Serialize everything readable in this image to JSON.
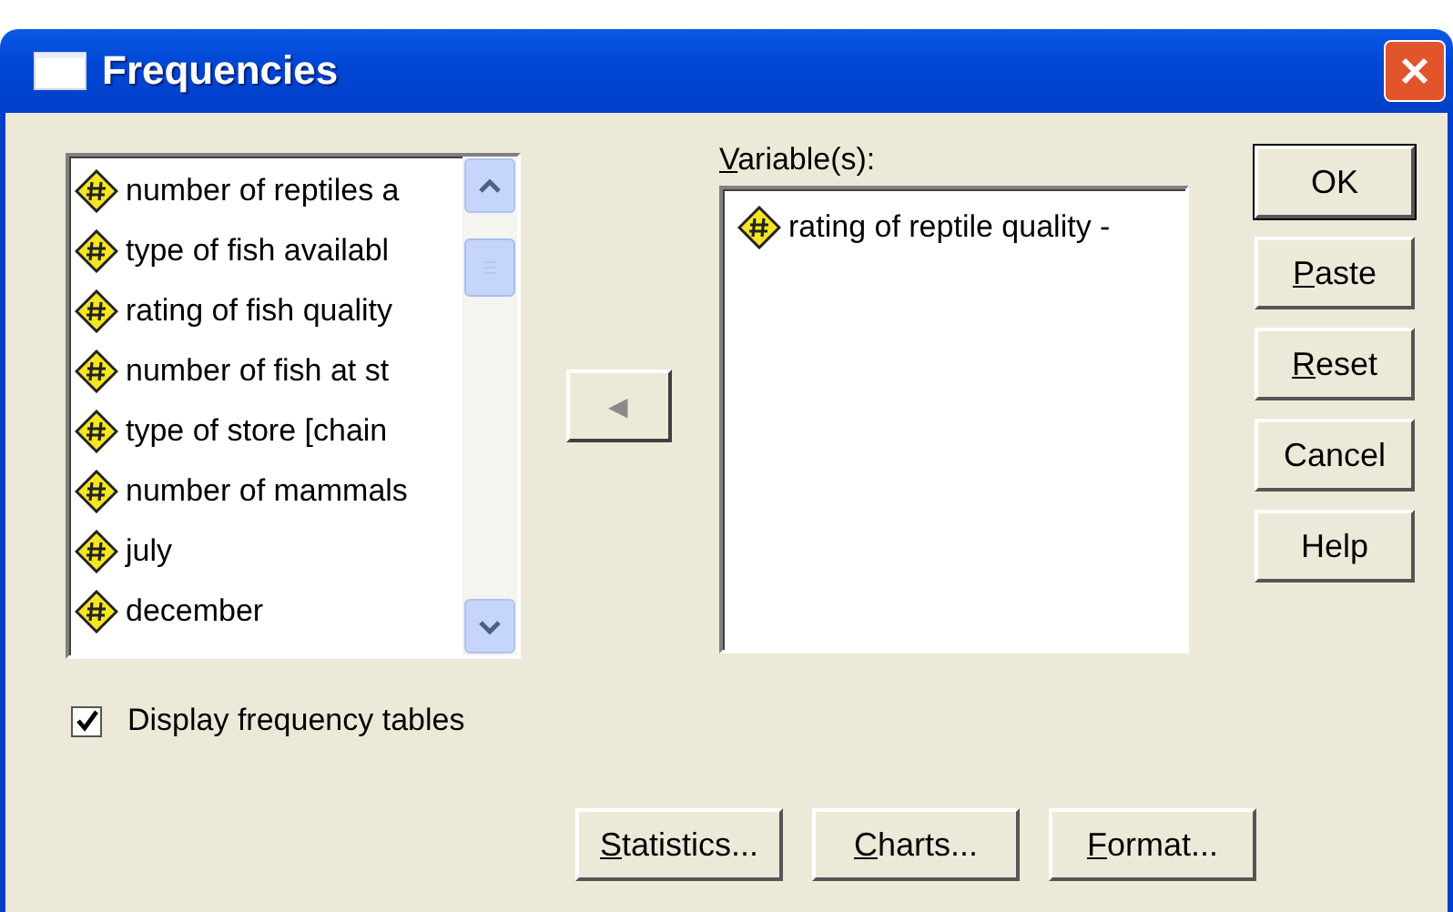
{
  "window": {
    "title": "Frequencies"
  },
  "source_list": {
    "items": [
      {
        "label": "number of reptiles a",
        "selected": false
      },
      {
        "label": "type of fish availabl",
        "selected": false
      },
      {
        "label": "rating of fish quality",
        "selected": false
      },
      {
        "label": "number of fish at st",
        "selected": false
      },
      {
        "label": "type of store [chain",
        "selected": false
      },
      {
        "label": "number of mammals",
        "selected": false
      },
      {
        "label": "july",
        "selected": false
      },
      {
        "label": "december",
        "selected": false
      }
    ]
  },
  "move_button": {
    "symbol": "◀",
    "disabled": true
  },
  "variables": {
    "access_key": "V",
    "label_rest": "ariable(s):",
    "items": [
      {
        "label": "rating of reptile quality -",
        "selected": false
      }
    ]
  },
  "side_buttons": [
    {
      "label": "OK",
      "default": true
    },
    {
      "access_key": "P",
      "label_rest": "aste",
      "default": false
    },
    {
      "access_key": "R",
      "label_rest": "eset",
      "default": false
    },
    {
      "label": "Cancel",
      "default": false
    },
    {
      "label": "Help",
      "default": false
    }
  ],
  "display_tables": {
    "label": "Display frequency tables",
    "checked": true
  },
  "bottom_buttons": [
    {
      "access_key": "S",
      "label_rest": "tatistics..."
    },
    {
      "access_key": "C",
      "label_rest": "harts..."
    },
    {
      "access_key": "F",
      "label_rest": "ormat..."
    }
  ]
}
